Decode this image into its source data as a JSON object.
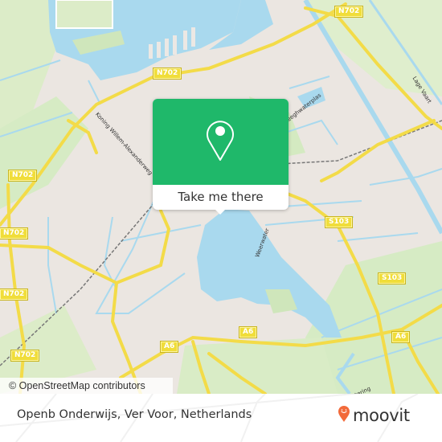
{
  "map": {
    "road_shields": [
      {
        "id": "n702-top-right",
        "label": "N702"
      },
      {
        "id": "n702-top-center",
        "label": "N702"
      },
      {
        "id": "n702-left-upper",
        "label": "N702"
      },
      {
        "id": "n702-left-mid",
        "label": "N702"
      },
      {
        "id": "n702-left-lower",
        "label": "N702"
      },
      {
        "id": "n702-bottom-left",
        "label": "N702"
      },
      {
        "id": "s103-upper",
        "label": "S103"
      },
      {
        "id": "s103-lower",
        "label": "S103"
      },
      {
        "id": "a6-center",
        "label": "A6"
      },
      {
        "id": "a6-right",
        "label": "A6"
      },
      {
        "id": "a6-left",
        "label": "A6"
      }
    ],
    "street_labels": {
      "koning": "Koning Willem-Alexanderweg",
      "leeghwaterplas": "Leeghwaterplas",
      "lage_vaart": "Lage Vaart",
      "weerwater": "Weerwater",
      "bottom_right": "tering"
    },
    "attribution": "© OpenStreetMap contributors"
  },
  "popup": {
    "icon": "map-pin-icon",
    "button_label": "Take me there",
    "color": "#1fb86a"
  },
  "footer": {
    "address": "Openb Onderwijs, Ver Voor, Netherlands",
    "logo_text": "moovit",
    "logo_color": "#f26a3a"
  }
}
